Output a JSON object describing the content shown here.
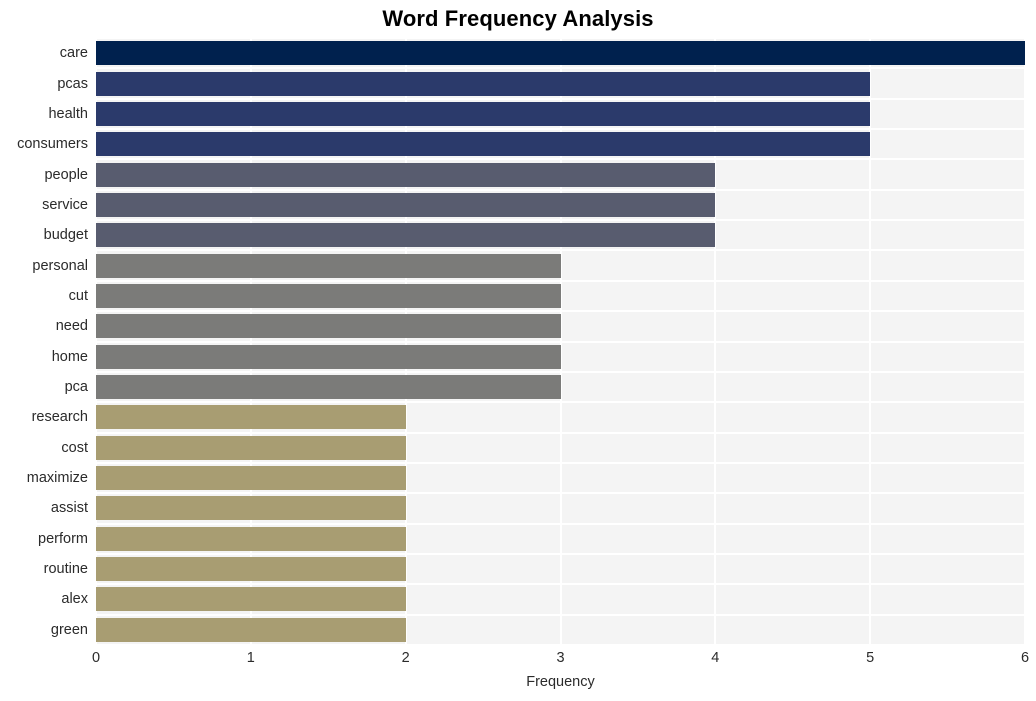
{
  "chart_data": {
    "type": "bar",
    "orientation": "horizontal",
    "title": "Word Frequency Analysis",
    "xlabel": "Frequency",
    "ylabel": "",
    "xlim": [
      0,
      6
    ],
    "xticks": [
      "0",
      "1",
      "2",
      "3",
      "4",
      "5",
      "6"
    ],
    "grid": true,
    "legend": "none",
    "categories": [
      "care",
      "pcas",
      "health",
      "consumers",
      "people",
      "service",
      "budget",
      "personal",
      "cut",
      "need",
      "home",
      "pca",
      "research",
      "cost",
      "maximize",
      "assist",
      "perform",
      "routine",
      "alex",
      "green"
    ],
    "values": [
      6,
      5,
      5,
      5,
      4,
      4,
      4,
      3,
      3,
      3,
      3,
      3,
      2,
      2,
      2,
      2,
      2,
      2,
      2,
      2
    ],
    "bar_colors": [
      "#00214e",
      "#2b3a6b",
      "#2b3a6b",
      "#2b3a6b",
      "#585c6f",
      "#585c6f",
      "#585c6f",
      "#7b7b79",
      "#7b7b79",
      "#7b7b79",
      "#7b7b79",
      "#7b7b79",
      "#a89d72",
      "#a89d72",
      "#a89d72",
      "#a89d72",
      "#a89d72",
      "#a89d72",
      "#a89d72",
      "#a89d72"
    ],
    "plot_background": "#f4f4f4",
    "gridline_color": "#ffffff",
    "figure_background": "#ffffff"
  }
}
